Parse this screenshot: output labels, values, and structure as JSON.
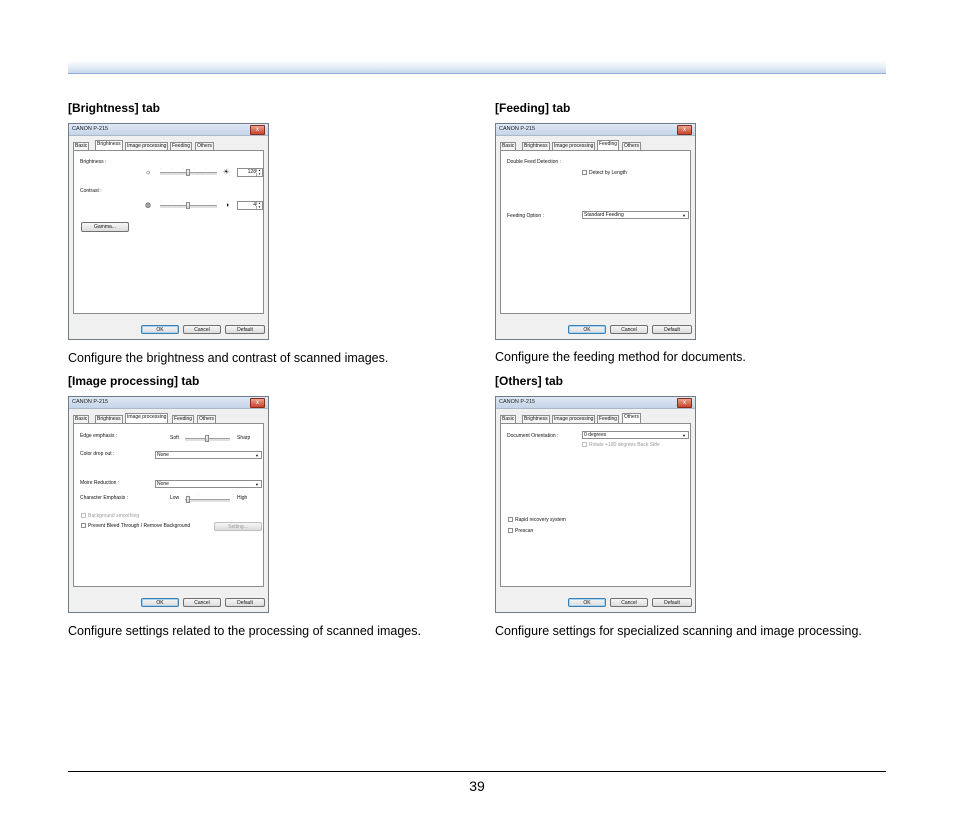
{
  "page": {
    "number": "39"
  },
  "dialog_common": {
    "title": "CANON  P-215",
    "close_glyph": "x",
    "ok": "OK",
    "cancel": "Cancel",
    "default": "Default",
    "tabs": [
      "Basic",
      "Brightness",
      "Image processing",
      "Feeding",
      "Others"
    ]
  },
  "sections": {
    "brightness": {
      "heading": "[Brightness] tab",
      "caption": "Configure the brightness and contrast of scanned images.",
      "active_tab": "Brightness",
      "brightness_label": "Brightness :",
      "brightness_value": "128",
      "contrast_label": "Contrast :",
      "contrast_value": "4",
      "gamma_button": "Gamma..."
    },
    "feeding": {
      "heading": "[Feeding] tab",
      "caption": "Configure the feeding method for documents.",
      "active_tab": "Feeding",
      "double_feed_label": "Double Feed Detection :",
      "detect_by_length": "Detect by Length",
      "feeding_option_label": "Feeding Option :",
      "feeding_option_value": "Standard Feeding"
    },
    "image_processing": {
      "heading": "[Image processing] tab",
      "caption": "Configure settings related to the processing of scanned images.",
      "active_tab": "Image processing",
      "edge_emphasis_label": "Edge emphasis :",
      "soft": "Soft",
      "sharp": "Sharp",
      "color_drop_label": "Color drop out :",
      "color_drop_value": "None",
      "moire_label": "Moire Reduction :",
      "moire_value": "None",
      "char_emphasis_label": "Character Emphasis :",
      "low": "Low",
      "high": "High",
      "background_smoothing": "Background smoothing",
      "prevent_bleed": "Prevent Bleed Through / Remove Background",
      "setting_button": "Setting..."
    },
    "others": {
      "heading": "[Others] tab",
      "caption": "Configure settings for specialized scanning and image processing.",
      "active_tab": "Others",
      "orientation_label": "Document Orientation :",
      "orientation_value": "0 degrees",
      "rotate_back": "Rotate +180 degrees Back Side",
      "rapid_recovery": "Rapid recovery system",
      "prescan": "Prescan"
    }
  }
}
